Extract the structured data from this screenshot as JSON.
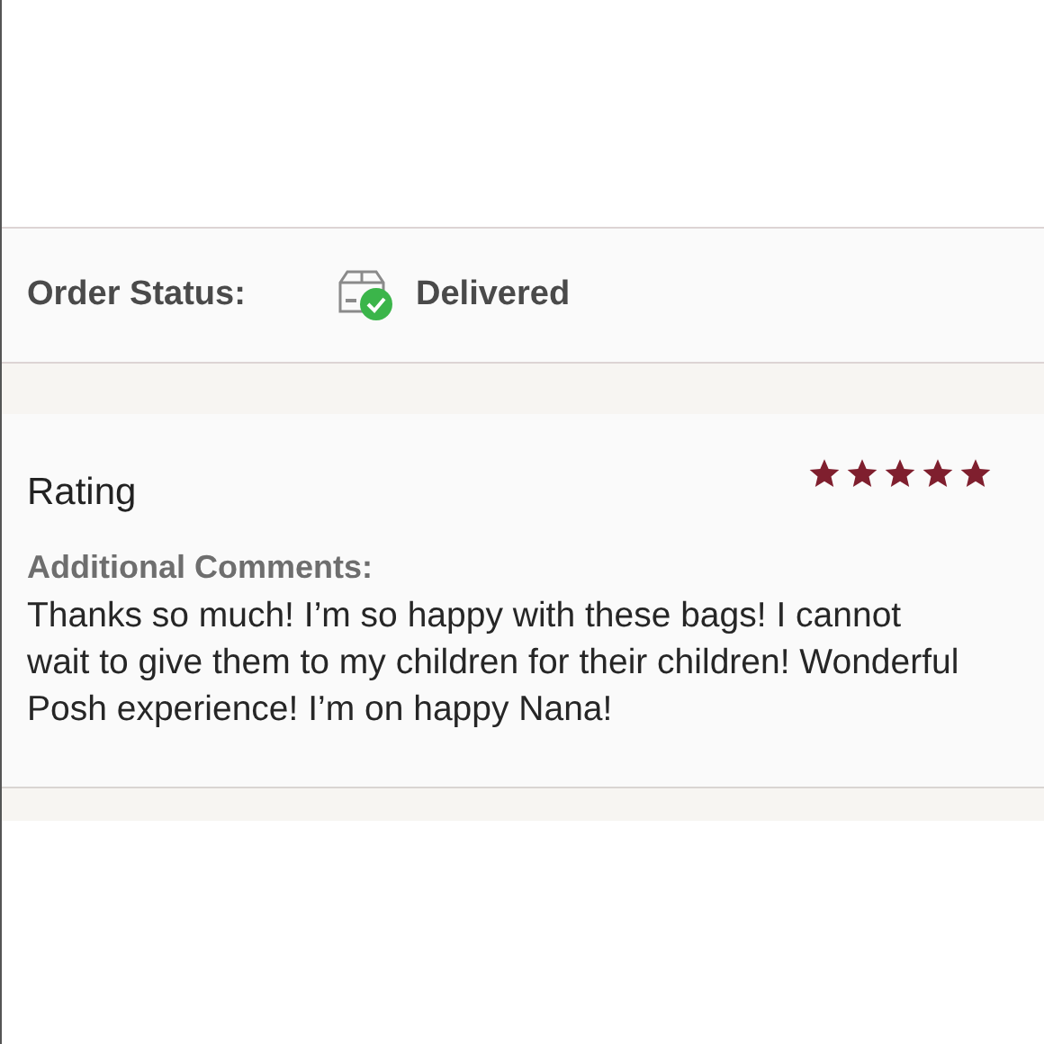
{
  "order_status": {
    "label": "Order Status:",
    "value": "Delivered"
  },
  "rating": {
    "label": "Rating",
    "stars": 5
  },
  "comments": {
    "label": "Additional Comments:",
    "text": "Thanks so much! I’m so happy with these bags! I cannot wait to give them to my children for their children! Wonderful Posh experience! I’m on happy Nana!"
  }
}
